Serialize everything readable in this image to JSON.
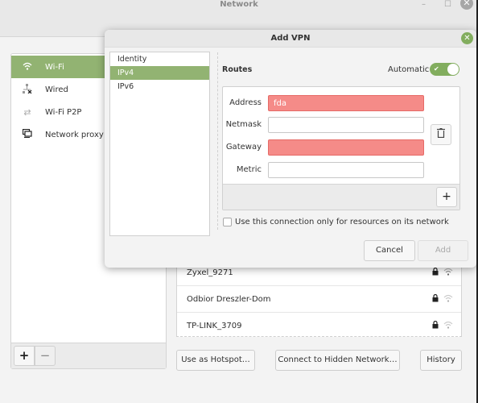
{
  "window": {
    "title": "Network",
    "controls": {
      "minimize": "–",
      "maximize": "☐",
      "close": "✕"
    }
  },
  "sidebar": {
    "items": [
      {
        "label": "Wi-Fi",
        "icon": "wifi-icon",
        "glyph": "📶",
        "active": true
      },
      {
        "label": "Wired",
        "icon": "wired-disconnected-icon",
        "glyph": "🖧",
        "active": false
      },
      {
        "label": "Wi-Fi P2P",
        "icon": "p2p-arrows-icon",
        "glyph": "⇄",
        "active": false
      },
      {
        "label": "Network proxy",
        "icon": "network-proxy-icon",
        "glyph": "🖳",
        "active": false
      }
    ],
    "add_label": "+",
    "remove_label": "−"
  },
  "networks": [
    {
      "name": "Zyxel_9271",
      "secured": true,
      "lock_glyph": "🔒",
      "signal_glyph": "◠"
    },
    {
      "name": "Odbior Dreszler-Dom",
      "secured": true,
      "lock_glyph": "🔒",
      "signal_glyph": "◠"
    },
    {
      "name": "TP-LINK_3709",
      "secured": true,
      "lock_glyph": "🔒",
      "signal_glyph": "◠"
    }
  ],
  "main_buttons": {
    "hotspot": "Use as Hotspot…",
    "hidden": "Connect to Hidden Network…",
    "history": "History"
  },
  "dialog": {
    "title": "Add VPN",
    "close_glyph": "✕",
    "nav": [
      {
        "label": "Identity",
        "active": false
      },
      {
        "label": "IPv4",
        "active": true
      },
      {
        "label": "IPv6",
        "active": false
      }
    ],
    "routes": {
      "heading": "Routes",
      "automatic_label": "Automatic",
      "automatic_on": true,
      "toggle_check": "✔",
      "fields": {
        "address": {
          "label": "Address",
          "value": "fda",
          "invalid": true
        },
        "netmask": {
          "label": "Netmask",
          "value": "",
          "invalid": false
        },
        "gateway": {
          "label": "Gateway",
          "value": "",
          "invalid": true
        },
        "metric": {
          "label": "Metric",
          "value": "",
          "invalid": false
        }
      },
      "delete_glyph": "🗑",
      "add_glyph": "+"
    },
    "only_resources_label": "Use this connection only for resources on its network",
    "only_resources_checked": false,
    "cancel_label": "Cancel",
    "add_label": "Add",
    "add_enabled": false
  },
  "colors": {
    "accent": "#92b372",
    "toggle": "#82ad5e",
    "error_field": "#f58b88"
  }
}
